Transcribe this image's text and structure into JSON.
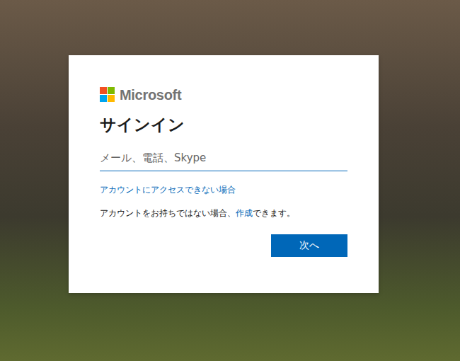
{
  "logo": {
    "text": "Microsoft"
  },
  "title": "サインイン",
  "field": {
    "placeholder": "メール、電話、Skype",
    "value": ""
  },
  "help_link": "アカウントにアクセスできない場合",
  "signup": {
    "before": "アカウントをお持ちではない場合、",
    "link": "作成",
    "after": "できます。"
  },
  "buttons": [
    {
      "label": "次へ",
      "primary": true
    }
  ]
}
